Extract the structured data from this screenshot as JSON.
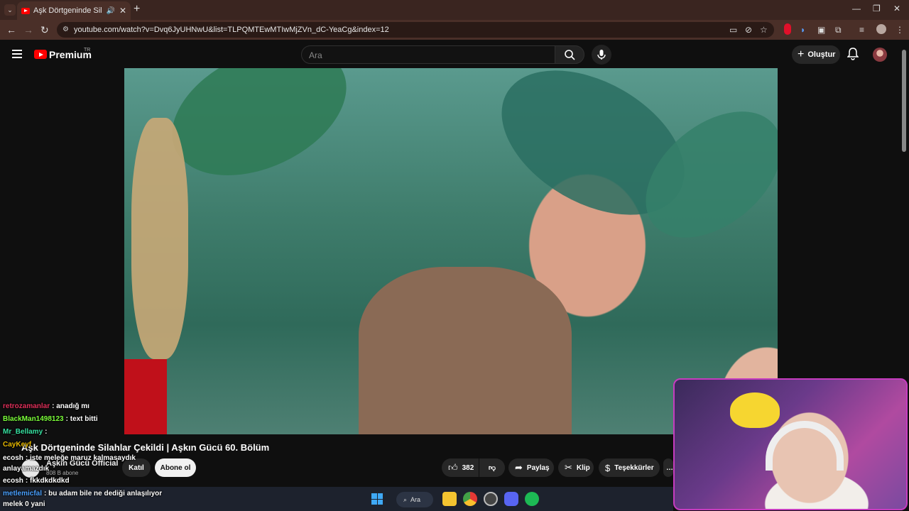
{
  "browser": {
    "tab_title": "Aşk Dörtgeninde Silahlar Ç",
    "speaker_glyph": "🔊",
    "close_glyph": "✕",
    "new_tab_glyph": "+",
    "url": "youtube.com/watch?v=Dvq6JyUHNwU&list=TLPQMTEwMTIwMjZVn_dC-YeaCg&index=12"
  },
  "masthead": {
    "brand": "Premium",
    "region": "TR",
    "search_placeholder": "Ara",
    "create_label": "Oluştur"
  },
  "video": {
    "title": "Aşk Dörtgeninde Silahlar Çekildi | Aşkın Gücü 60. Bölüm",
    "channel_name": "Aşkın Gücü Official",
    "subscribers": "808 B abone",
    "join_label": "Katıl",
    "subscribe_label": "Abone ol",
    "like_count": "382",
    "share_label": "Paylaş",
    "clip_label": "Klip",
    "thanks_label": "Teşekkürler"
  },
  "chat": [
    {
      "user": "retrozamanlar",
      "color": "#e0305a",
      "text": ": anadığ mı"
    },
    {
      "user": "BlackMan1498123",
      "color": "#7cff3a",
      "text": ": text bitti"
    },
    {
      "user": "Mr_Bellamy",
      "color": "#36e0a0",
      "text": ":"
    },
    {
      "user": "CayKeyf",
      "color": "#e6b800",
      "text": ""
    },
    {
      "user": "ecosh",
      "color": "#ffffff",
      "text": ": iste meleğe maruz kalmasaydık"
    },
    {
      "user": "",
      "color": "#ffffff",
      "text": "anlayamazdık"
    },
    {
      "user": "ecosh",
      "color": "#ffffff",
      "text": ": fkkdkdkdkd"
    },
    {
      "user": "metlemicfal",
      "color": "#4aa0ff",
      "text": ": bu adam bile ne dediği anlaşılıyor"
    },
    {
      "user": "",
      "color": "#ffffff",
      "text": "melek 0 yani"
    }
  ],
  "taskbar": {
    "search_label": "Ara"
  }
}
